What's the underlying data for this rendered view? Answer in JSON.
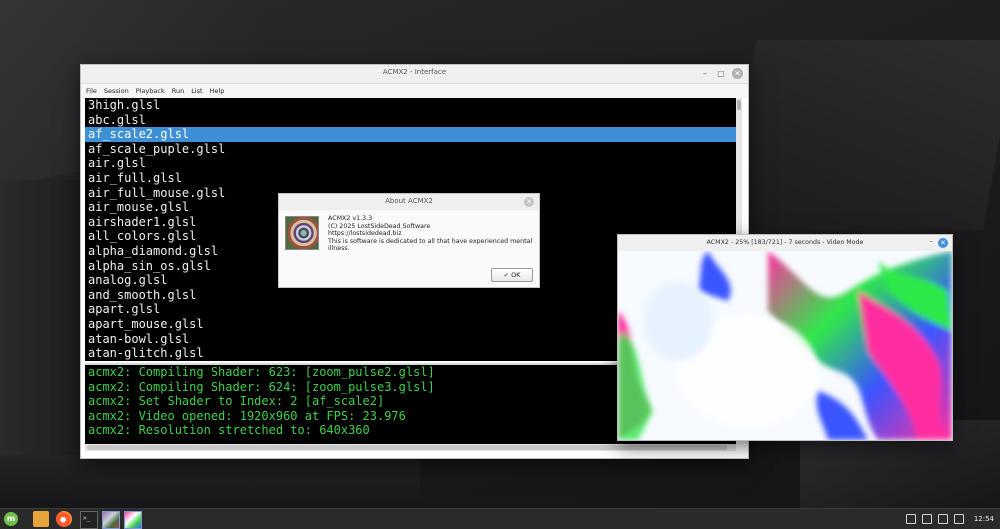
{
  "main_window": {
    "title": "ACMX2 - Interface",
    "menu": [
      "File",
      "Session",
      "Playback",
      "Run",
      "List",
      "Help"
    ],
    "shader_list": [
      "3high.glsl",
      "abc.glsl",
      "af_scale2.glsl",
      "af_scale_puple.glsl",
      "air.glsl",
      "air_full.glsl",
      "air_full_mouse.glsl",
      "air_mouse.glsl",
      "airshader1.glsl",
      "all_colors.glsl",
      "alpha_diamond.glsl",
      "alpha_sin_os.glsl",
      "analog.glsl",
      "and_smooth.glsl",
      "apart.glsl",
      "apart_mouse.glsl",
      "atan-bowl.glsl",
      "atan-glitch.glsl"
    ],
    "selected_index": 2,
    "console_lines": [
      "acmx2: Compiling Shader: 623: [zoom_pulse2.glsl]",
      "acmx2: Compiling Shader: 624: [zoom_pulse3.glsl]",
      "acmx2: Set Shader to Index: 2 [af_scale2]",
      "acmx2: Video opened: 1920x960 at FPS: 23.976",
      "acmx2: Resolution stretched to: 640x360"
    ]
  },
  "about_dialog": {
    "title": "About ACMX2",
    "lines": [
      "ACMX2 v1.3.3",
      "(C) 2025 LostSideDead Software",
      "https://lostsidedead.biz",
      "This is software is dedicated to all that have experienced mental illness."
    ],
    "ok_label": "OK"
  },
  "video_window": {
    "title": "ACMX2 - 25% [183/721] - 7 seconds - Video Mode"
  },
  "taskbar": {
    "clock": "12:54",
    "terminal_glyph": ">_"
  },
  "colors": {
    "selection": "#3d8fd6",
    "console_text": "#3fd04a",
    "list_bg": "#000000"
  }
}
